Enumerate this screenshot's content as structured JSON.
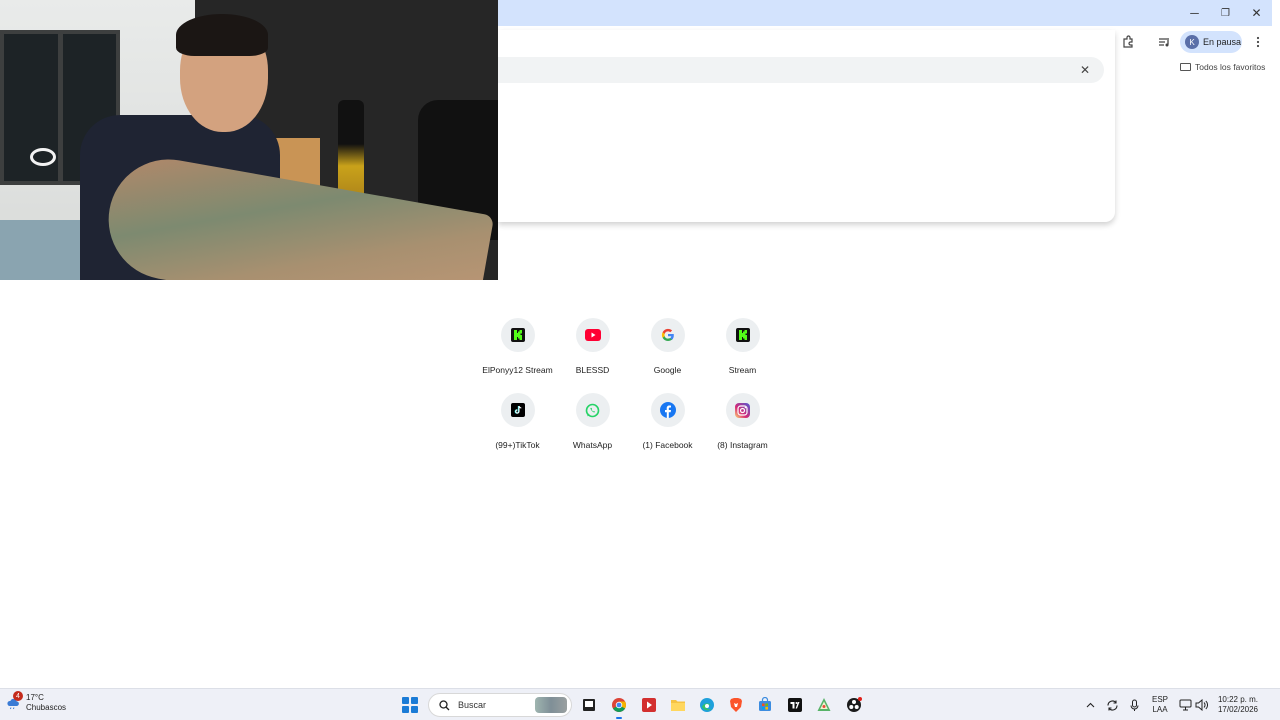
{
  "browser": {
    "window_controls": {
      "minimize": "─",
      "restore": "❐",
      "close": "✕"
    },
    "profile": {
      "initial": "K",
      "status": "En pausa",
      "color": "#5a6fa8",
      "chip_color": "#d3e3fd"
    },
    "bookmarks": {
      "all_bookmarks": "Todos los favoritos"
    },
    "omnibox": {
      "clear_symbol": "✕"
    },
    "toolbar_icons": [
      "extensions-icon",
      "media-controls-icon",
      "more-options-icon"
    ]
  },
  "new_tab": {
    "shortcuts": [
      {
        "label": "ElPonyy12 Stream",
        "icon": "kick-icon",
        "color": "#53fc18"
      },
      {
        "label": "BLESSD",
        "icon": "youtube-icon",
        "color": "#ff0033"
      },
      {
        "label": "Google",
        "icon": "google-icon",
        "color": "#4285f4"
      },
      {
        "label": "Stream",
        "icon": "kick-icon",
        "color": "#53fc18"
      },
      {
        "label": "(99+)TikTok",
        "icon": "tiktok-icon",
        "color": "#000000"
      },
      {
        "label": "WhatsApp",
        "icon": "whatsapp-icon",
        "color": "#25d366"
      },
      {
        "label": "(1) Facebook",
        "icon": "facebook-icon",
        "color": "#1877f2"
      },
      {
        "label": "(8) Instagram",
        "icon": "instagram-icon",
        "color": "#e1306c"
      }
    ]
  },
  "taskbar": {
    "weather": {
      "temperature": "17°C",
      "condition": "Chubascos",
      "badge": "4"
    },
    "search_placeholder": "Buscar",
    "apps": [
      "file-explorer-icon",
      "chrome-icon",
      "streaming-app-icon",
      "folder-icon",
      "edge-icon",
      "brave-icon",
      "store-icon",
      "tradingview-icon",
      "maps-icon",
      "obs-icon"
    ],
    "tray": {
      "language": "ESP",
      "layout": "LAA",
      "time": "10:22 p. m.",
      "date": "17/02/2026"
    }
  }
}
